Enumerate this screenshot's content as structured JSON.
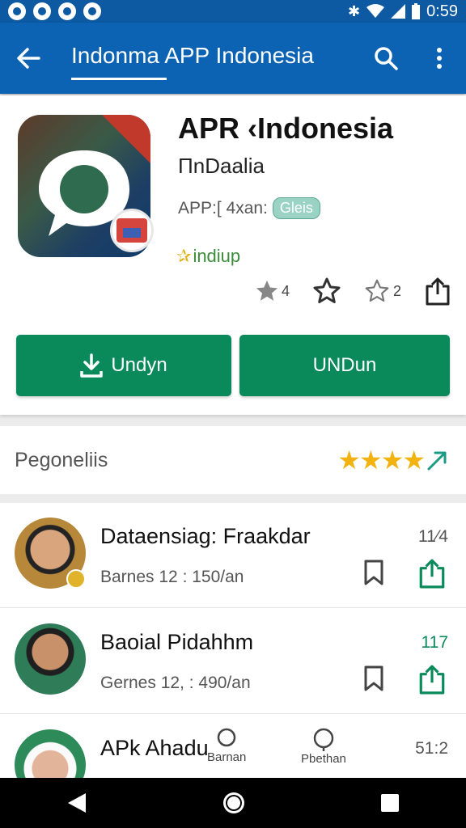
{
  "status_bar": {
    "time": "0:59",
    "icons": [
      "notif-1",
      "notif-2",
      "notif-3",
      "notif-4",
      "bluetooth-icon",
      "wifi-icon",
      "signal-icon",
      "battery-icon"
    ]
  },
  "app_bar": {
    "title": "Indonma APP Indonesia",
    "back_icon": "arrow-left-icon",
    "search_icon": "search-icon",
    "more_icon": "more-vert-icon",
    "color": "#0d63b3"
  },
  "app": {
    "name": "APR ‹Indonesia",
    "developer": "ΠnDaalia",
    "meta_label": "APP:[ 4xan:",
    "meta_chip": "Gleis",
    "award": "indiup",
    "actions": [
      {
        "icon": "star-half-icon",
        "value": "4"
      },
      {
        "icon": "star-outline-icon",
        "value": ""
      },
      {
        "icon": "star-outline-icon",
        "value": "2"
      },
      {
        "icon": "share-icon",
        "value": ""
      }
    ],
    "install_label": "Undyn",
    "open_label": "UNDun",
    "accent": "#0a8a5b"
  },
  "reviews": {
    "title": "Pegoneliis",
    "rating": 4,
    "items": [
      {
        "name": "Dataensiag: Fraakdar",
        "meta": "Barnes 12 : 150/an",
        "count": "11⁄4"
      },
      {
        "name": "Baoial Pidahhm",
        "meta": "Gernes 12, : 490/an",
        "count": "117"
      },
      {
        "name": "APk   Ahadu",
        "meta": "",
        "count": "51:2"
      }
    ]
  },
  "mini_nav": [
    {
      "label": "Barnan",
      "icon": "pin-icon"
    },
    {
      "label": "Pbethan",
      "icon": "pin-icon"
    }
  ]
}
